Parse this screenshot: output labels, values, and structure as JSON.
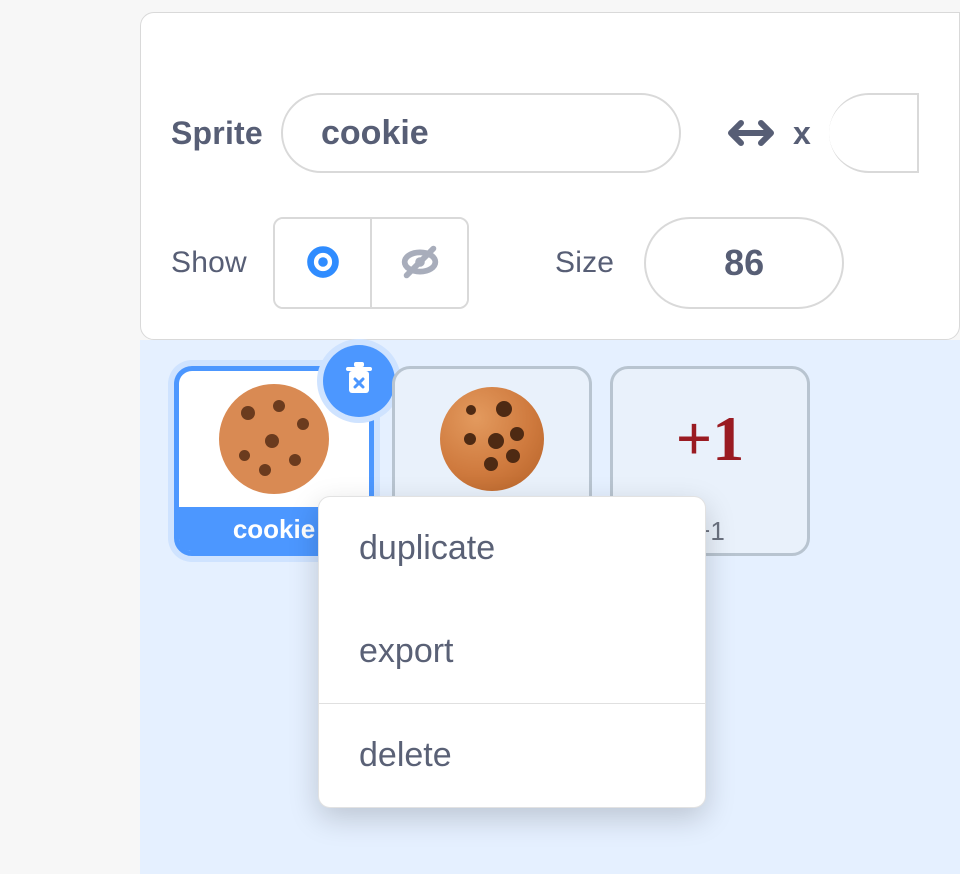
{
  "labels": {
    "sprite": "Sprite",
    "show": "Show",
    "size": "Size",
    "x": "x"
  },
  "sprite": {
    "name": "cookie",
    "size": "86",
    "x": ""
  },
  "thumbs": [
    {
      "key": "cookie",
      "label": "cookie",
      "kind": "cookie-flat",
      "selected": true
    },
    {
      "key": "cookie2",
      "label": "",
      "kind": "cookie-shaded",
      "selected": false
    },
    {
      "key": "plus-one",
      "label": "+1",
      "kind": "plus1",
      "selected": false
    }
  ],
  "plus1_text": "+1",
  "context_menu": {
    "items": [
      "duplicate",
      "export"
    ],
    "danger": "delete"
  },
  "colors": {
    "cookie_flat": "#d98a53",
    "cookie_shaded": "#cf7a3e",
    "chip": "#6b3b1e",
    "primary": "#4c97ff"
  }
}
